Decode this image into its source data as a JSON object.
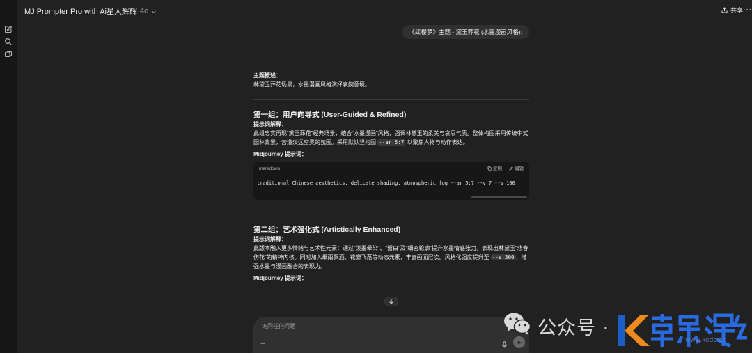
{
  "topbar": {
    "model_name": "MJ Prompter Pro with Ai星人辉辉",
    "model_version": "4o",
    "share_label": "共享",
    "more_label": "···"
  },
  "user_message": "《红楼梦》主题 - 黛玉葬花 (水墨漫画风格):",
  "assistant": {
    "theme_title": "主题概述：",
    "theme_text": "林黛玉葬花场景，水墨漫画风格演绎哀婉意境。",
    "group1": {
      "heading": "第一组：用户向导式 (User-Guided & Refined)",
      "explain_title": "提示词解释：",
      "explain_text_before": "此组忠实再现“黛玉葬花”经典场景，结合“水墨漫画”风格，强调林黛玉的柔美与哀思气质。整体构图采用传统中式园林背景，营造淡远空灵的氛围。采用默认竖构图 ",
      "explain_code": "--ar 5:7",
      "explain_text_after": " 以聚焦人物与动作表达。",
      "prompt_title": "Midjourney 提示词：",
      "code_lang": "markdown",
      "copy_label": "复制",
      "edit_label": "编辑",
      "code": "traditional Chinese aesthetics, delicate shading, atmospheric fog --ar 5:7 --v 7 --s 100"
    },
    "group2": {
      "heading": "第二组：艺术强化式 (Artistically Enhanced)",
      "explain_title": "提示词解释：",
      "explain_text_before": "此版本融入更多情绪与艺术性元素：通过“泼墨晕染”、“留白”及“细密轮廓”提升水墨情感张力，表现出林黛玉“悲春伤花”的精神内核。同时加入细雨飘洒、花瓣飞落等动态元素，丰富画面层次。风格化强度提升至 ",
      "explain_code": "--s 300",
      "explain_text_after": "，增强水墨与漫画融合的表现力。",
      "prompt_title": "Midjourney 提示词："
    }
  },
  "composer": {
    "placeholder": "询问任何问题",
    "plus_label": "+"
  },
  "watermark": {
    "text": "公众号 ·",
    "url": "www.kedo.cc"
  },
  "colors": {
    "background": "#212121",
    "sidebar": "#171717",
    "bubble": "#303030",
    "codeblock": "#171717",
    "text": "#ececec",
    "brand_orange": "#f08a1c",
    "brand_blue": "#1d5fc6"
  }
}
